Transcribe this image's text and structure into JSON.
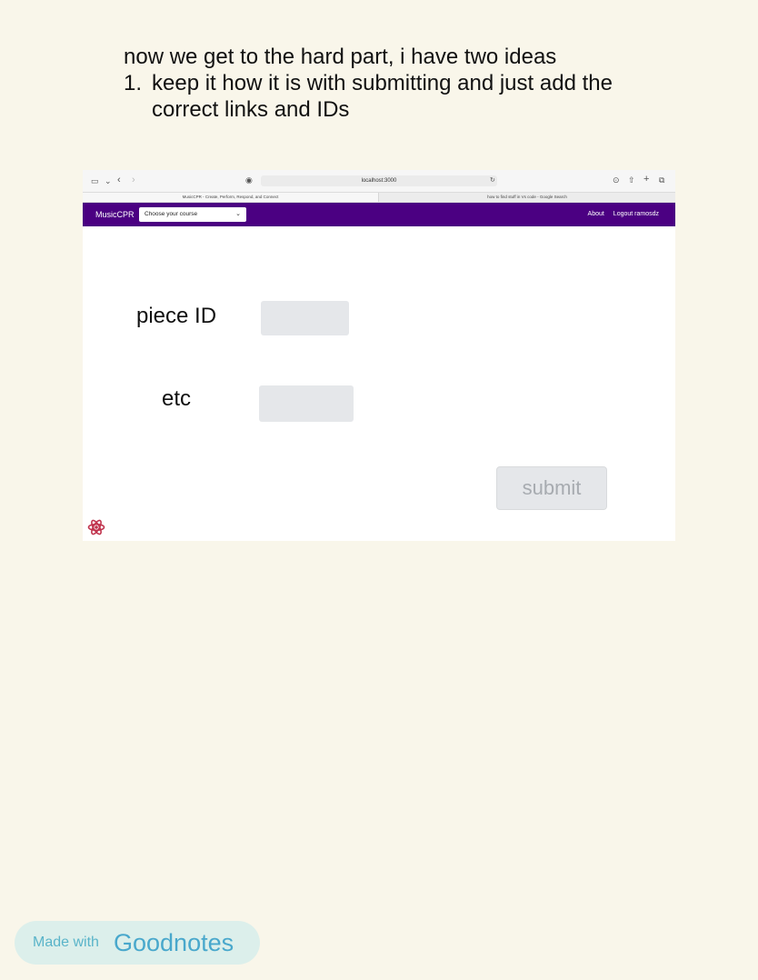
{
  "note": {
    "intro": "now we get to the hard part, i have two ideas",
    "items": [
      {
        "number": "1.",
        "line1": "keep it how it is with submitting and just add the",
        "line2": "correct links and IDs"
      }
    ]
  },
  "browser": {
    "address": "localhost:3000",
    "tabs": [
      "MusicCPR - Create, Perform, Respond, and Connect",
      "how to find stuff in Vs code - Google Search"
    ]
  },
  "app": {
    "brand": "MusicCPR",
    "course_select": "Choose your course",
    "nav_links": [
      "About",
      "Logout ramosdz"
    ],
    "fields": [
      {
        "label": "piece ID",
        "value": ""
      },
      {
        "label": "etc",
        "value": ""
      }
    ],
    "submit_label": "submit"
  },
  "footer": {
    "made_with": "Made with",
    "brand": "Goodnotes"
  }
}
